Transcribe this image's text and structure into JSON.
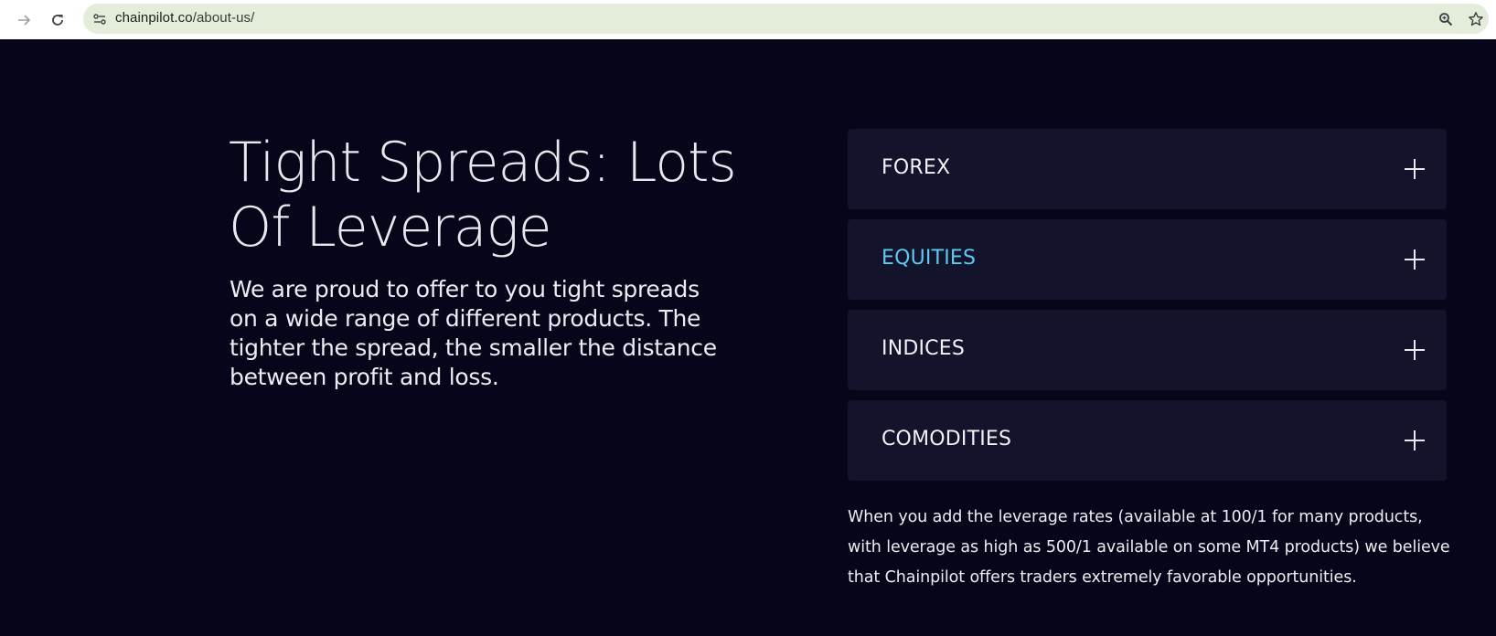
{
  "browser": {
    "url_host": "chainpilot.co",
    "url_path": "/about-us/",
    "icons": {
      "back": "arrow-back-icon",
      "reload": "reload-icon",
      "site_info": "site-settings-icon",
      "zoom": "zoom-icon",
      "bookmark": "star-icon"
    }
  },
  "hero": {
    "title": "Tight Spreads: Lots Of Leverage",
    "text": "We are proud to offer to you tight spreads on a wide range of different products. The tighter the spread, the smaller the distance between profit and loss."
  },
  "accordion": {
    "items": [
      {
        "label": "FOREX",
        "active": false
      },
      {
        "label": "EQUITIES",
        "active": true
      },
      {
        "label": "INDICES",
        "active": false
      },
      {
        "label": "COMODITIES",
        "active": false
      }
    ]
  },
  "leverage_text": "When you add the leverage rates (available at 100/1 for many products, with leverage as high as 500/1 available on some MT4 products) we believe that Chainpilot offers traders extremely favorable opportunities.",
  "colors": {
    "background": "#06061a",
    "panel": "#13132c",
    "accent": "#5ec9ef",
    "omnibox": "#e4ecda"
  }
}
